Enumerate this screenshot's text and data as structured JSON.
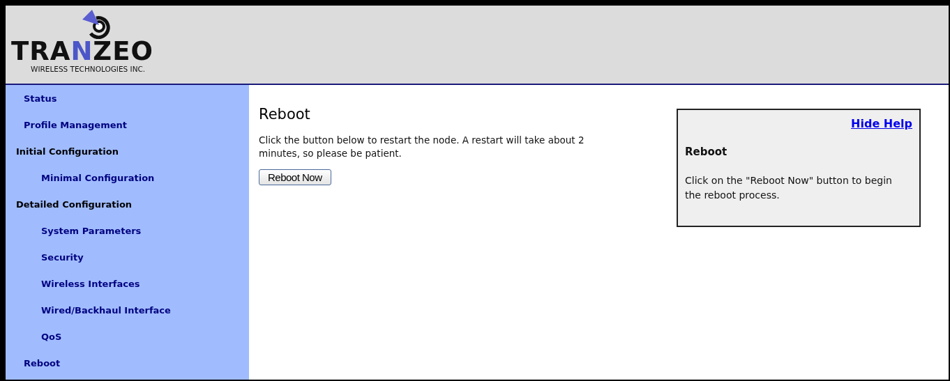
{
  "logo": {
    "wordmark": [
      {
        "text": "TRA",
        "accent": false
      },
      {
        "text": "N",
        "accent": true
      },
      {
        "text": "ZEO",
        "accent": false
      }
    ],
    "tagline": "WIRELESS TECHNOLOGIES INC."
  },
  "sidebar": {
    "items": [
      {
        "kind": "link",
        "label": "Status"
      },
      {
        "kind": "link",
        "label": "Profile Management"
      },
      {
        "kind": "section",
        "label": "Initial Configuration",
        "children": [
          {
            "kind": "link",
            "label": "Minimal Configuration"
          }
        ]
      },
      {
        "kind": "section",
        "label": "Detailed Configuration",
        "children": [
          {
            "kind": "link",
            "label": "System Parameters"
          },
          {
            "kind": "link",
            "label": "Security"
          },
          {
            "kind": "link",
            "label": "Wireless Interfaces"
          },
          {
            "kind": "link",
            "label": "Wired/Backhaul Interface"
          },
          {
            "kind": "link",
            "label": "QoS"
          }
        ]
      },
      {
        "kind": "link",
        "label": "Reboot"
      }
    ]
  },
  "content": {
    "title": "Reboot",
    "description": "Click the button below to restart the node. A restart will take about 2 minutes, so please be patient.",
    "button": "Reboot Now"
  },
  "help": {
    "toggle": "Hide Help",
    "title": "Reboot",
    "text": "Click on the \"Reboot Now\" button to begin the reboot process."
  }
}
